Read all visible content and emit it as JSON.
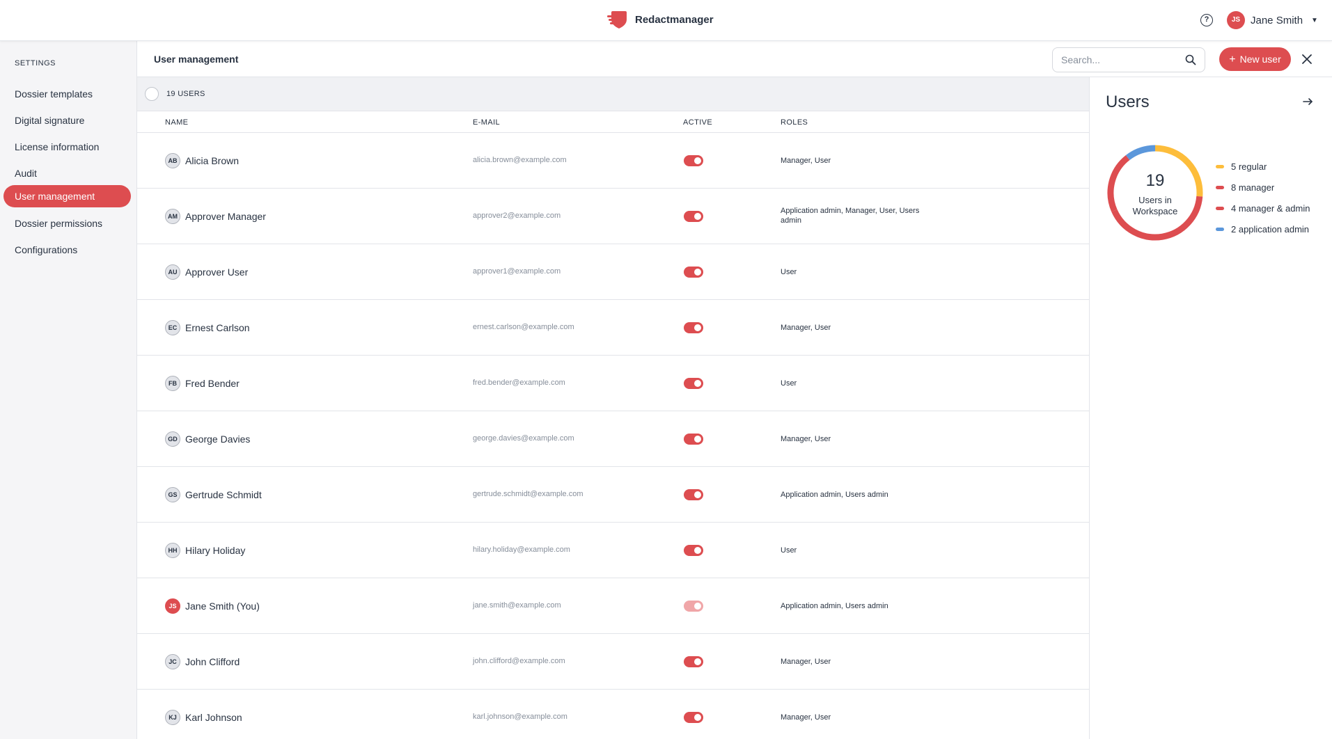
{
  "app": {
    "name": "Redactmanager"
  },
  "current_user": {
    "initials": "JS",
    "name": "Jane Smith"
  },
  "sidebar": {
    "section": "SETTINGS",
    "items": [
      {
        "label": "Dossier templates",
        "active": false
      },
      {
        "label": "Digital signature",
        "active": false
      },
      {
        "label": "License information",
        "active": false
      },
      {
        "label": "Audit",
        "active": false
      },
      {
        "label": "User management",
        "active": true
      },
      {
        "label": "Dossier permissions",
        "active": false
      },
      {
        "label": "Configurations",
        "active": false
      }
    ]
  },
  "header": {
    "title": "User management",
    "search_placeholder": "Search...",
    "new_user_label": "New user"
  },
  "table": {
    "count_label": "19 USERS",
    "columns": {
      "name": "NAME",
      "email": "E-MAIL",
      "active": "ACTIVE",
      "roles": "ROLES"
    },
    "rows": [
      {
        "initials": "AB",
        "name": "Alicia Brown",
        "email": "alicia.brown@example.com",
        "active": true,
        "roles": "Manager, User"
      },
      {
        "initials": "AM",
        "name": "Approver Manager",
        "email": "approver2@example.com",
        "active": true,
        "roles": "Application admin, Manager, User, Users admin"
      },
      {
        "initials": "AU",
        "name": "Approver User",
        "email": "approver1@example.com",
        "active": true,
        "roles": "User"
      },
      {
        "initials": "EC",
        "name": "Ernest Carlson",
        "email": "ernest.carlson@example.com",
        "active": true,
        "roles": "Manager, User"
      },
      {
        "initials": "FB",
        "name": "Fred Bender",
        "email": "fred.bender@example.com",
        "active": true,
        "roles": "User"
      },
      {
        "initials": "GD",
        "name": "George Davies",
        "email": "george.davies@example.com",
        "active": true,
        "roles": "Manager, User"
      },
      {
        "initials": "GS",
        "name": "Gertrude Schmidt",
        "email": "gertrude.schmidt@example.com",
        "active": true,
        "roles": "Application admin, Users admin"
      },
      {
        "initials": "HH",
        "name": "Hilary Holiday",
        "email": "hilary.holiday@example.com",
        "active": true,
        "roles": "User"
      },
      {
        "initials": "JS",
        "name": "Jane Smith (You)",
        "email": "jane.smith@example.com",
        "active": true,
        "disabled": true,
        "roles": "Application admin, Users admin"
      },
      {
        "initials": "JC",
        "name": "John Clifford",
        "email": "john.clifford@example.com",
        "active": true,
        "roles": "Manager, User"
      },
      {
        "initials": "KJ",
        "name": "Karl Johnson",
        "email": "karl.johnson@example.com",
        "active": true,
        "roles": "Manager, User"
      }
    ]
  },
  "panel": {
    "title": "Users",
    "total": "19",
    "total_caption": "Users in Workspace",
    "legend": [
      {
        "label": "5 regular",
        "value": 5,
        "color": "#fdbd3b"
      },
      {
        "label": "8 manager",
        "value": 8,
        "color": "#dd4d50"
      },
      {
        "label": "4 manager & admin",
        "value": 4,
        "color": "#dd4d50"
      },
      {
        "label": "2 application admin",
        "value": 2,
        "color": "#5b97db"
      }
    ]
  },
  "colors": {
    "accent": "#dd4d50",
    "regular": "#fdbd3b",
    "admin": "#5b97db"
  }
}
